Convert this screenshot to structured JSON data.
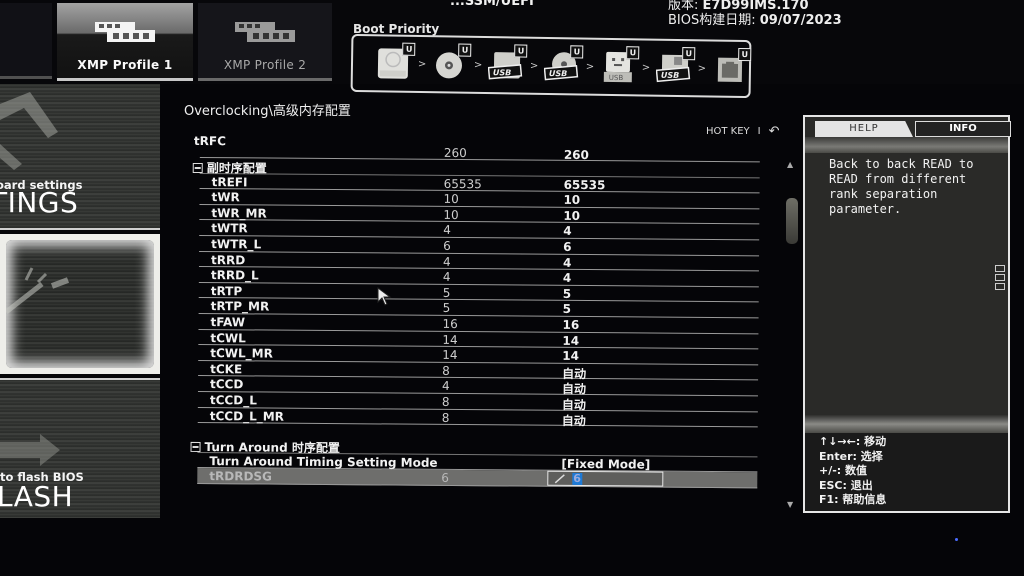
{
  "header": {
    "top_info": "...",
    "top_path": "...SSM/UEFI",
    "bios_version_label": "版本:",
    "bios_version": "E7D99IMS.170",
    "bios_date_label": "BIOS构建日期:",
    "bios_date": "09/07/2023"
  },
  "xmp_tabs": [
    {
      "label": "XMP Profile 1",
      "active": true
    },
    {
      "label": "XMP Profile 2",
      "active": false
    }
  ],
  "boot_priority": {
    "label": "Boot Priority",
    "devices": [
      {
        "icon": "hard-disk-icon",
        "badge": "U"
      },
      {
        "icon": "optical-disc-icon",
        "badge": "U"
      },
      {
        "icon": "usb-hard-disk-icon",
        "badge": "U",
        "tag": "USB"
      },
      {
        "icon": "usb-optical-disc-icon",
        "badge": "U",
        "tag": "USB"
      },
      {
        "icon": "usb-key-icon",
        "badge": "U",
        "tag": "USB"
      },
      {
        "icon": "usb-floppy-icon",
        "badge": "U",
        "tag": "USB"
      },
      {
        "icon": "network-icon",
        "badge": "U"
      }
    ],
    "separator": ">"
  },
  "side_panels": {
    "settings": {
      "subtitle": "oard settings",
      "title": "TINGS"
    },
    "oc": {
      "subtitle": "",
      "title": ""
    },
    "mflash": {
      "subtitle": "to flash BIOS",
      "title": "LASH"
    }
  },
  "main": {
    "breadcrumb": "Overclocking\\高级内存配置",
    "hotkey_label": "HOT KEY",
    "hotkey_sep": "I",
    "back_icon": "↶",
    "top_row": {
      "name": "tRFC",
      "default": "260",
      "current": "260"
    },
    "sections": [
      {
        "title": "副时序配置",
        "rows": [
          {
            "name": "tREFI",
            "default": "65535",
            "current": "65535"
          },
          {
            "name": "tWR",
            "default": "10",
            "current": "10"
          },
          {
            "name": "tWR_MR",
            "default": "10",
            "current": "10"
          },
          {
            "name": "tWTR",
            "default": "4",
            "current": "4"
          },
          {
            "name": "tWTR_L",
            "default": "6",
            "current": "6"
          },
          {
            "name": "tRRD",
            "default": "4",
            "current": "4"
          },
          {
            "name": "tRRD_L",
            "default": "4",
            "current": "4"
          },
          {
            "name": "tRTP",
            "default": "5",
            "current": "5"
          },
          {
            "name": "tRTP_MR",
            "default": "5",
            "current": "5"
          },
          {
            "name": "tFAW",
            "default": "16",
            "current": "16"
          },
          {
            "name": "tCWL",
            "default": "14",
            "current": "14"
          },
          {
            "name": "tCWL_MR",
            "default": "14",
            "current": "14"
          },
          {
            "name": "tCKE",
            "default": "8",
            "current": "自动"
          },
          {
            "name": "tCCD",
            "default": "4",
            "current": "自动"
          },
          {
            "name": "tCCD_L",
            "default": "8",
            "current": "自动"
          },
          {
            "name": "tCCD_L_MR",
            "default": "8",
            "current": "自动"
          }
        ]
      },
      {
        "title": "Turn Around 时序配置",
        "rows": [
          {
            "name": "Turn Around Timing Setting Mode",
            "default": "",
            "current": "[Fixed Mode]"
          },
          {
            "name": "tRDRDSG",
            "default": "6",
            "current": "6",
            "selected": true,
            "editing": true
          }
        ]
      }
    ]
  },
  "help_panel": {
    "tabs": [
      {
        "label": "HELP",
        "active": true
      },
      {
        "label": "INFO",
        "active": false
      }
    ],
    "text": "Back to back READ to READ from different rank separation parameter.",
    "keys": [
      "↑↓→←: 移动",
      "Enter: 选择",
      "+/-: 数值",
      "ESC: 退出",
      "F1: 帮助信息"
    ]
  },
  "colors": {
    "background": "#050508",
    "panel": "#2a2a28",
    "selected_row": "#6e6e6c",
    "edit_highlight": "#1e7ad6",
    "text": "#f2f2f2"
  }
}
